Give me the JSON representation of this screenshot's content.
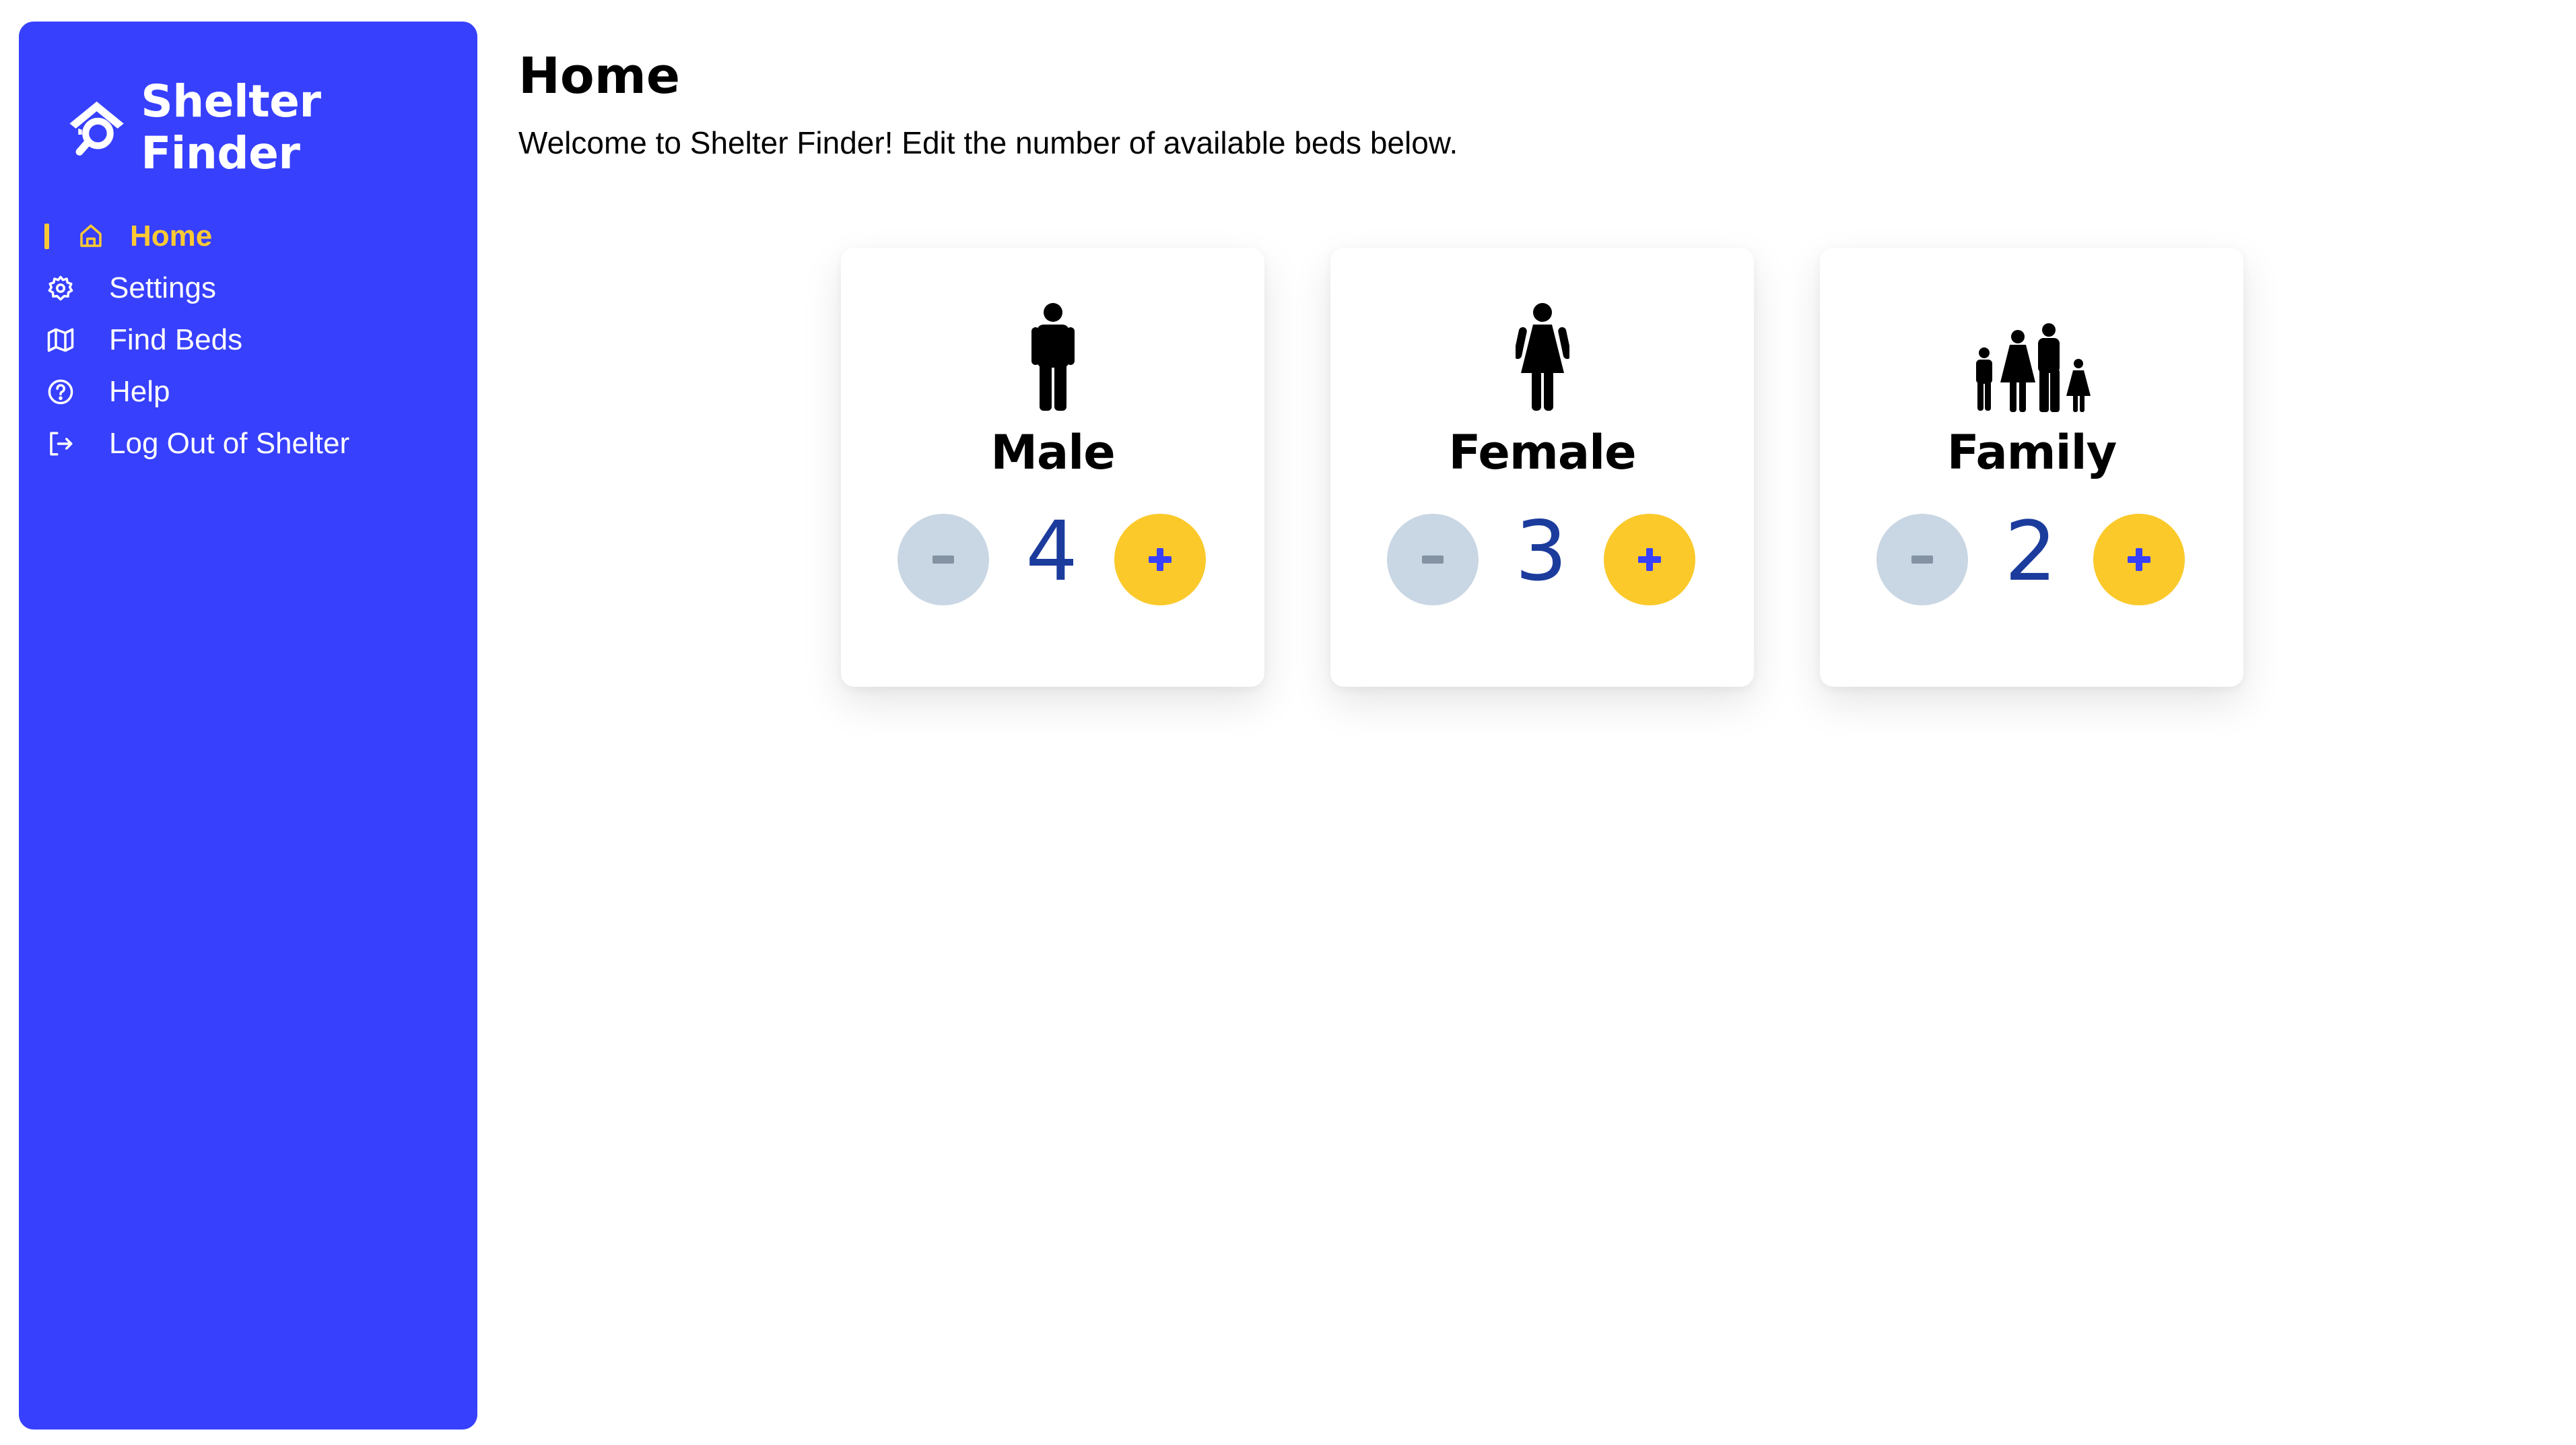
{
  "app": {
    "name": "Shelter Finder",
    "logo_icon": "house-search-icon",
    "accent_color": "#3740fd",
    "highlight_color": "#fcc934"
  },
  "sidebar": {
    "items": [
      {
        "label": "Home",
        "icon": "home-icon",
        "active": true
      },
      {
        "label": "Settings",
        "icon": "gear-icon",
        "active": false
      },
      {
        "label": "Find Beds",
        "icon": "map-icon",
        "active": false
      },
      {
        "label": "Help",
        "icon": "help-circle-icon",
        "active": false
      },
      {
        "label": "Log Out of Shelter",
        "icon": "logout-icon",
        "active": false
      }
    ]
  },
  "main": {
    "title": "Home",
    "subtitle": "Welcome to Shelter Finder! Edit the number of available beds below."
  },
  "cards": [
    {
      "label": "Male",
      "icon": "male-person-icon",
      "count": "4",
      "minus": "-",
      "plus": "+"
    },
    {
      "label": "Female",
      "icon": "female-person-icon",
      "count": "3",
      "minus": "-",
      "plus": "+"
    },
    {
      "label": "Family",
      "icon": "family-icon",
      "count": "2",
      "minus": "-",
      "plus": "+"
    }
  ]
}
